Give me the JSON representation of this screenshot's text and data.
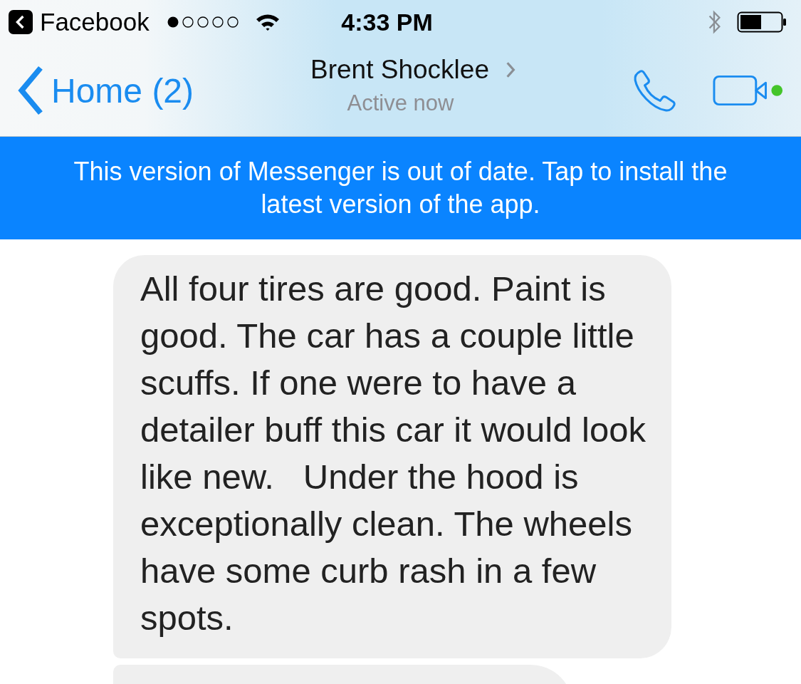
{
  "status_bar": {
    "back_app": "Facebook",
    "time": "4:33 PM"
  },
  "nav": {
    "back_label": "Home (2)",
    "contact_name": "Brent Shocklee",
    "presence": "Active now",
    "video_online": true
  },
  "banner": {
    "text": "This version of Messenger is out of date. Tap to install the latest version of the app."
  },
  "messages": [
    {
      "kind": "text",
      "text": "All four tires are good. Paint is good. The car has a couple little scuffs. If one were to have a detailer buff this car it would look like new.   Under the hood is exceptionally clean. The wheels have some curb rash in a few spots."
    },
    {
      "kind": "cut_off"
    }
  ]
}
